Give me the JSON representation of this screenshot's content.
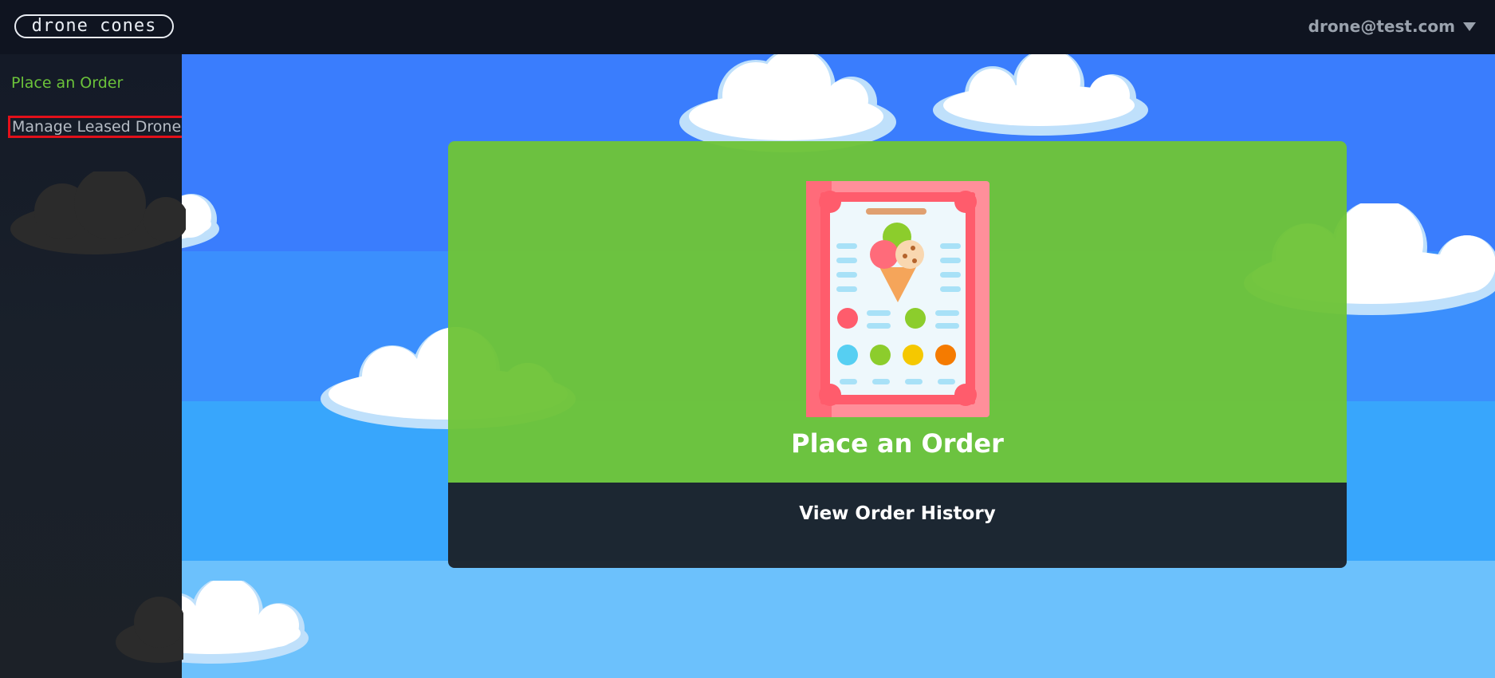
{
  "header": {
    "logo_text": "drone cones",
    "user_email": "drone@test.com"
  },
  "sidebar": {
    "items": [
      {
        "label": "Place an Order",
        "active": true
      },
      {
        "label": "Manage Leased Drone",
        "active": false
      }
    ]
  },
  "main": {
    "order_card": {
      "title": "Place an Order"
    },
    "history_button": {
      "label": "View Order History"
    }
  },
  "colors": {
    "accent_green": "#6bc23a",
    "header_bg": "#0f1420",
    "sky_blue": "#3a7dfd",
    "highlight_red": "#e3101a"
  }
}
